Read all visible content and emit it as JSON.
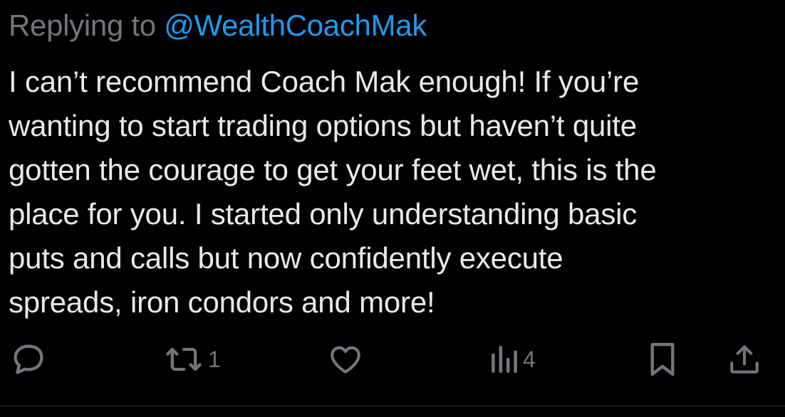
{
  "reply": {
    "prefix": "Replying to ",
    "handle": "@WealthCoachMak"
  },
  "tweet": {
    "lines": [
      "I can’t recommend Coach Mak enough!  If you’re",
      "wanting to start trading options but haven’t quite",
      "gotten the courage to get your feet wet, this is the",
      "place for you.  I started only understanding basic",
      "puts and calls but now confidently execute",
      "spreads, iron condors and more!"
    ]
  },
  "actions": {
    "reply_icon": "reply-bubble-icon",
    "repost_icon": "repost-icon",
    "repost_count": "1",
    "like_icon": "heart-icon",
    "views_icon": "views-bar-chart-icon",
    "views_count": "4",
    "bookmark_icon": "bookmark-icon",
    "share_icon": "share-upload-icon"
  },
  "colors": {
    "background": "#000000",
    "text": "#e7e9ea",
    "muted": "#71767b",
    "link": "#1d9bf0",
    "divider": "#2f3336"
  }
}
